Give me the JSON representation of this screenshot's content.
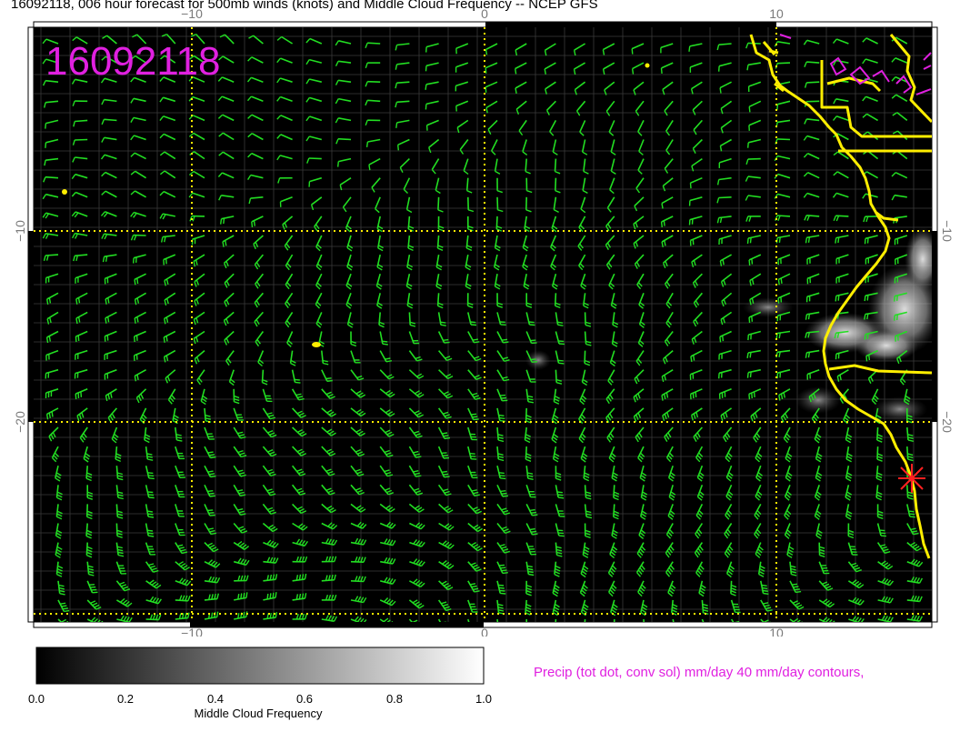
{
  "title": "16092118, 006 hour forecast for 500mb winds (knots) and Middle Cloud Frequency -- NCEP GFS",
  "stamp": "16092118",
  "axes": {
    "x_ticks_top": [
      "−10",
      "0",
      "10"
    ],
    "x_ticks_bottom": [
      "−10",
      "0",
      "10"
    ],
    "y_ticks_left": [
      "−10",
      "−20"
    ],
    "y_ticks_right": [
      "−10",
      "−20"
    ],
    "lon_range": [
      -16.5,
      15.5
    ],
    "lat_range": [
      -30,
      -1.5
    ]
  },
  "colors": {
    "background": "#000000",
    "wind_barbs": "#22dd22",
    "coastline": "#ffee00",
    "grid_dotted": "#ffee00",
    "precip_contours": "#e020e0",
    "station_marker": "#ff2020",
    "stamp": "#e020e0"
  },
  "colorbar": {
    "label": "Middle Cloud Frequency",
    "ticks": [
      "0.0",
      "0.2",
      "0.4",
      "0.6",
      "0.8",
      "1.0"
    ]
  },
  "precip_note": "Precip (tot dot, conv sol) mm/day 40 mm/day contours,",
  "icons": {
    "station": "red-asterisk-station-icon"
  }
}
